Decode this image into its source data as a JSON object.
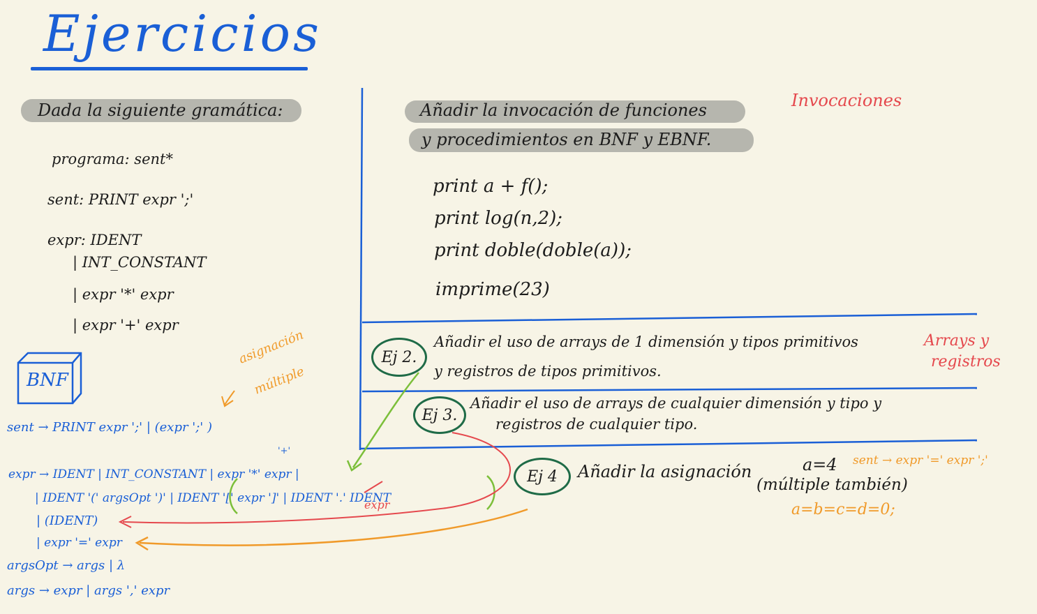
{
  "title": "Ejercicios",
  "left": {
    "intro": "Dada la siguiente gramática:",
    "grammar": [
      "programa: sent*",
      "sent: PRINT expr ';'",
      "expr: IDENT",
      "| INT_CONSTANT",
      "| expr '*' expr",
      "| expr '+' expr"
    ],
    "bnf_label": "BNF",
    "annotation": [
      "asignación",
      "múltiple"
    ],
    "bnf_rules": [
      "sent → PRINT expr ';' | (expr ';' )",
      "expr → IDENT | INT_CONSTANT | expr '*' expr |",
      "| IDENT '(' argsOpt ')' | IDENT '[' expr ']' | IDENT '.' IDENT",
      "| (IDENT)",
      "| expr '=' expr",
      "argsOpt → args | λ",
      "args → expr | args ',' expr"
    ],
    "plus_mark": "'+'",
    "correction": "expr"
  },
  "right": {
    "ex1_lines": [
      "Añadir la invocación de funciones",
      "y procedimientos en BNF y EBNF."
    ],
    "ex1_tag": "Invocaciones",
    "code": [
      "print a + f();",
      "print log(n,2);",
      "print doble(doble(a));",
      "imprime(23)"
    ],
    "ex2": {
      "label": "Ej 2.",
      "lines": [
        "Añadir el uso de arrays de 1 dimensión y tipos primitivos",
        "y registros de tipos primitivos."
      ],
      "tag": [
        "Arrays y",
        "registros"
      ]
    },
    "ex3": {
      "label": "Ej 3.",
      "lines": [
        "Añadir el uso de arrays de cualquier dimensión y tipo y",
        "registros de cualquier tipo."
      ]
    },
    "ex4": {
      "label": "Ej 4",
      "lines": [
        "Añadir la asignación",
        "a=4",
        "(múltiple también)"
      ],
      "rule": "sent → expr '=' expr ';'",
      "example": "a=b=c=d=0;"
    }
  },
  "colors": {
    "background": "#f7f4e6",
    "ink": "#1c1c1c",
    "blue": "#1a5fd6",
    "orange": "#f09a2a",
    "red": "#e5484d",
    "green": "#1f6b47",
    "lime": "#7cbf3a",
    "highlight": "#b6b6ae"
  }
}
